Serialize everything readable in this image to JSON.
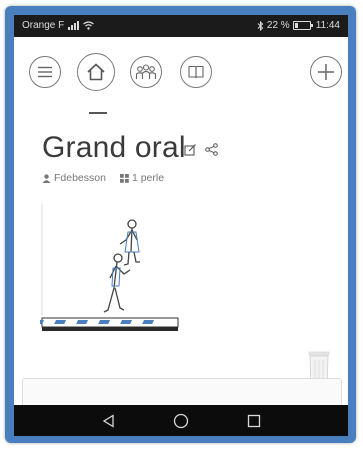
{
  "status_bar": {
    "carrier": "Orange F",
    "battery_percent": "22 %",
    "time": "11:44",
    "icons": [
      "signal-icon",
      "wifi-icon",
      "bluetooth-icon",
      "battery-icon"
    ]
  },
  "toolbar": {
    "items": [
      {
        "name": "menu",
        "icon": "hamburger-menu-icon"
      },
      {
        "name": "home",
        "icon": "home-icon",
        "active": true
      },
      {
        "name": "community",
        "icon": "people-icon"
      },
      {
        "name": "library",
        "icon": "book-icon"
      },
      {
        "name": "add",
        "icon": "plus-icon"
      }
    ]
  },
  "page": {
    "title": "Grand oral",
    "author": "Fdebesson",
    "pearls_count": "1 perle"
  },
  "colors": {
    "frame_blue": "#4a7fbf",
    "status_bar": "#1b1b1b",
    "nav_bar": "#0c0c0c",
    "accent_stripe": "#4a7fbf"
  }
}
